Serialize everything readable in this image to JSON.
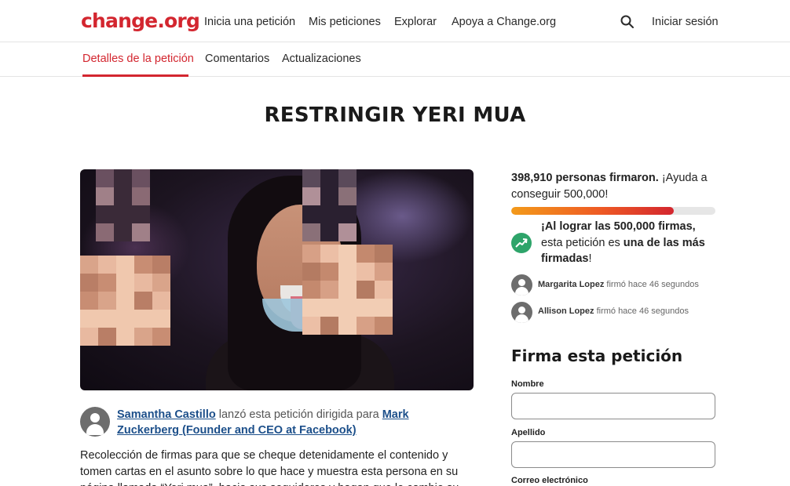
{
  "header": {
    "logo": "change.org",
    "nav": [
      "Inicia una petición",
      "Mis peticiones",
      "Explorar",
      "Apoya a Change.org"
    ],
    "login": "Iniciar sesión"
  },
  "tabs": [
    "Detalles de la petición",
    "Comentarios",
    "Actualizaciones"
  ],
  "petition": {
    "title": "RESTRINGIR YERI MUA",
    "starter_name": "Samantha Castillo",
    "starter_text": "lanzó esta petición dirigida para",
    "target": "Mark Zuckerberg (Founder and CEO at Facebook)",
    "description": "Recolección de firmas para que se cheque detenidamente el contenido y tomen cartas en el asunto sobre lo que hace y muestra esta persona en su página llamada “Yeri mua”, hacia sus seguidores y hagan que le cambie su"
  },
  "stats": {
    "count": "398,910 personas firmaron.",
    "count_cta": "¡Ayuda a conseguir 500,000!",
    "progress_fraction": 0.7978,
    "trend_1": "¡Al lograr las 500,000 firmas,",
    "trend_2": "esta petición es",
    "trend_3": "una de las más firmadas",
    "trend_4": "!"
  },
  "recent_signers": [
    {
      "name": "Margarita Lopez",
      "text": "firmó hace 46 segundos"
    },
    {
      "name": "Allison Lopez",
      "text": "firmó hace 46 segundos"
    }
  ],
  "form": {
    "title": "Firma esta petición",
    "first_name_label": "Nombre",
    "last_name_label": "Apellido",
    "email_label": "Correo electrónico"
  },
  "colors": {
    "brand": "#d3262f",
    "link": "#1c4f8a",
    "trend": "#2ea46a"
  }
}
